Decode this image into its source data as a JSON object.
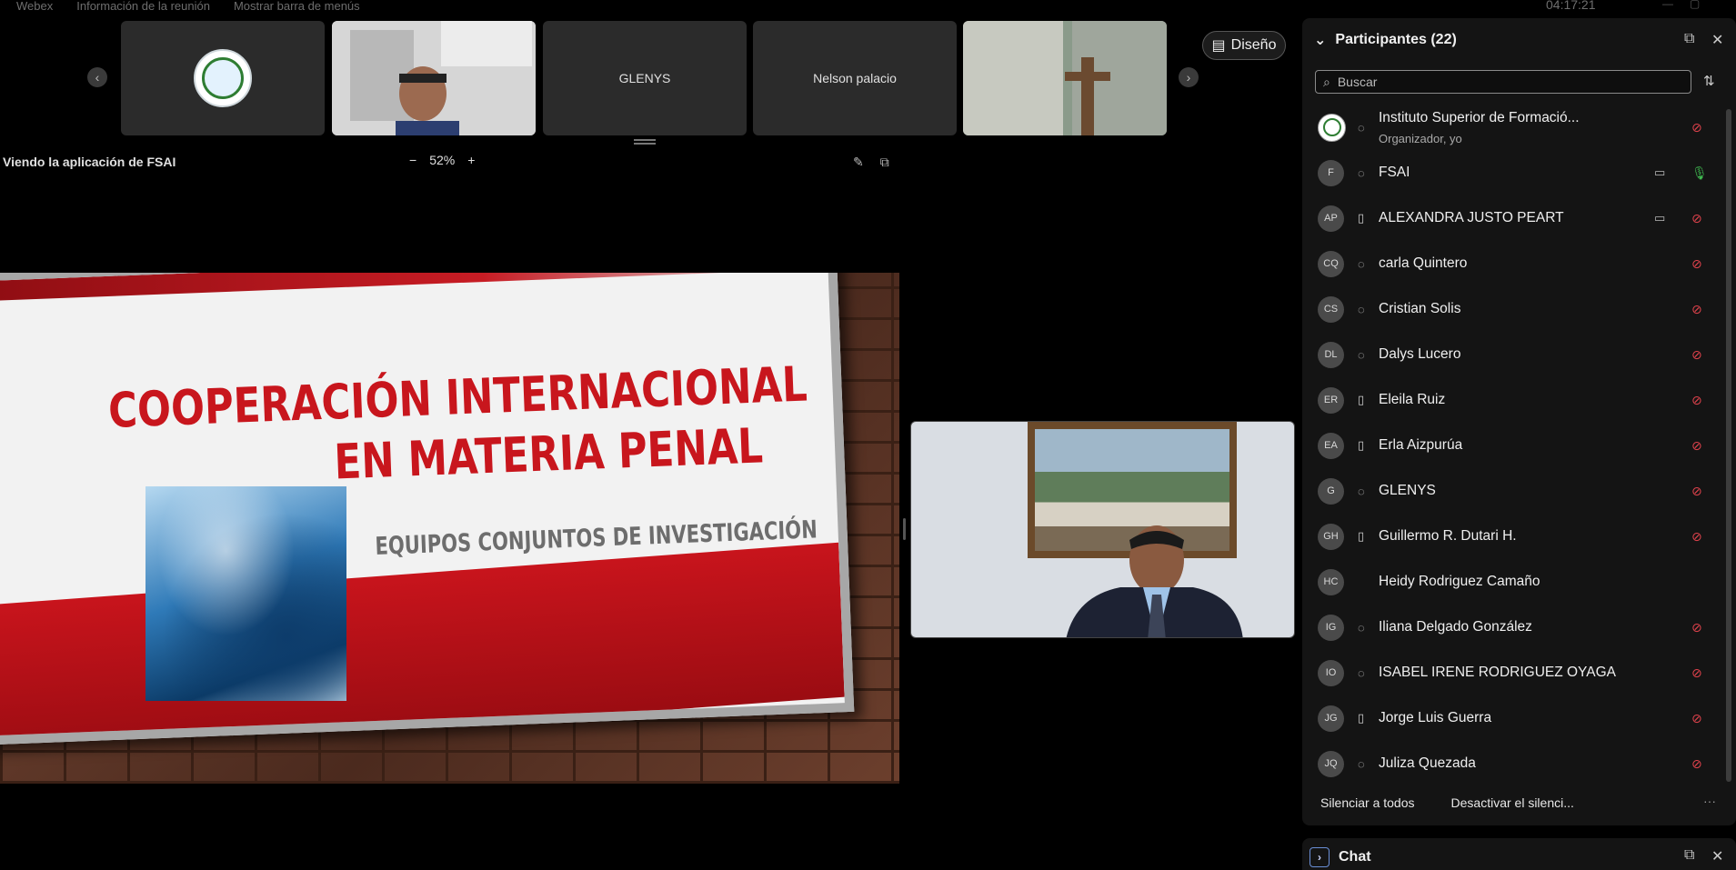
{
  "menu": {
    "app": "Webex",
    "meeting_info": "Información de la reunión",
    "show_menu": "Mostrar barra de menús"
  },
  "clock": "04:17:21",
  "thumbnails": [
    {
      "label": "",
      "kind": "logo"
    },
    {
      "label": "",
      "kind": "video"
    },
    {
      "label": "GLENYS",
      "kind": "name"
    },
    {
      "label": "Nelson palacio",
      "kind": "name"
    },
    {
      "label": "",
      "kind": "video"
    }
  ],
  "layout_button": "Diseño",
  "share": {
    "title": "Viendo la aplicación de FSAI",
    "zoom": "52%",
    "zoom_out": "−",
    "zoom_in": "+"
  },
  "slide": {
    "title_line1": "COOPERACIÓN INTERNACIONAL",
    "title_line2": "EN MATERIA PENAL",
    "subtitle": "EQUIPOS CONJUNTOS DE INVESTIGACIÓN"
  },
  "participants": {
    "header": "Participantes (22)",
    "search_placeholder": "Buscar",
    "list": [
      {
        "initials": "",
        "name": "Instituto Superior de Formació...",
        "sub": "Organizador, yo",
        "device": "headset",
        "cam": false,
        "mic": "muted",
        "org": true
      },
      {
        "initials": "F",
        "name": "FSAI",
        "sub": "",
        "device": "headset",
        "cam": true,
        "mic": "on"
      },
      {
        "initials": "AP",
        "name": "ALEXANDRA JUSTO PEART",
        "sub": "",
        "device": "phone",
        "cam": true,
        "mic": "muted"
      },
      {
        "initials": "CQ",
        "name": "carla Quintero",
        "sub": "",
        "device": "headset",
        "cam": false,
        "mic": "muted"
      },
      {
        "initials": "CS",
        "name": "Cristian Solis",
        "sub": "",
        "device": "headset",
        "cam": false,
        "mic": "muted"
      },
      {
        "initials": "DL",
        "name": "Dalys Lucero",
        "sub": "",
        "device": "headset",
        "cam": false,
        "mic": "muted"
      },
      {
        "initials": "ER",
        "name": "Eleila Ruiz",
        "sub": "",
        "device": "phone",
        "cam": false,
        "mic": "muted"
      },
      {
        "initials": "EA",
        "name": "Erla Aizpurúa",
        "sub": "",
        "device": "phone",
        "cam": false,
        "mic": "muted"
      },
      {
        "initials": "G",
        "name": "GLENYS",
        "sub": "",
        "device": "headset",
        "cam": false,
        "mic": "muted"
      },
      {
        "initials": "GH",
        "name": "Guillermo R. Dutari H.",
        "sub": "",
        "device": "phone",
        "cam": false,
        "mic": "muted"
      },
      {
        "initials": "HC",
        "name": "Heidy Rodriguez Camaño",
        "sub": "",
        "device": "",
        "cam": false,
        "mic": ""
      },
      {
        "initials": "IG",
        "name": "Iliana Delgado González",
        "sub": "",
        "device": "headset",
        "cam": false,
        "mic": "muted"
      },
      {
        "initials": "IO",
        "name": "ISABEL IRENE RODRIGUEZ OYAGA",
        "sub": "",
        "device": "headset",
        "cam": false,
        "mic": "muted"
      },
      {
        "initials": "JG",
        "name": "Jorge Luis Guerra",
        "sub": "",
        "device": "phone",
        "cam": false,
        "mic": "muted"
      },
      {
        "initials": "JQ",
        "name": "Juliza Quezada",
        "sub": "",
        "device": "headset",
        "cam": false,
        "mic": "muted"
      }
    ],
    "mute_all": "Silenciar a todos",
    "unmute_all": "Desactivar el silenci...",
    "more": "···"
  },
  "chat": {
    "title": "Chat"
  },
  "colors": {
    "accent_red": "#c8161d",
    "mic_muted": "#e0424c",
    "mic_on": "#3fb950"
  }
}
